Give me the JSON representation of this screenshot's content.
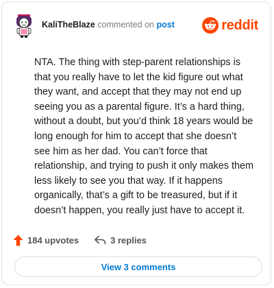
{
  "header": {
    "username": "KaliTheBlaze",
    "action_text": "commented on",
    "post_link": "post",
    "brand_name": "reddit"
  },
  "comment": {
    "text": "NTA. The thing with step-parent relationships is that you really have to let the kid figure out what they want, and accept that they may not end up seeing you as a parental figure. It’s a hard thing, without a doubt, but you’d think 18 years would be long enough for him to accept that she doesn’t see him as her dad. You can’t force that relationship, and trying to push it only makes them less likely to see you that way. If it happens organically, that’s a gift to be treasured, but if it doesn’t happen, you really just have to accept it."
  },
  "footer": {
    "upvotes_label": "184 upvotes",
    "replies_label": "3 replies",
    "view_comments_label": "View 3 comments"
  },
  "icons": {
    "upvote": "upvote-arrow-icon",
    "reply": "reply-arrow-icon",
    "brand": "reddit-snoo-icon",
    "avatar": "user-avatar"
  },
  "colors": {
    "brand": "#ff4500",
    "link": "#0079d3",
    "upvote": "#ff4500",
    "text": "#1c1c1c",
    "muted": "#7c7c7c"
  }
}
